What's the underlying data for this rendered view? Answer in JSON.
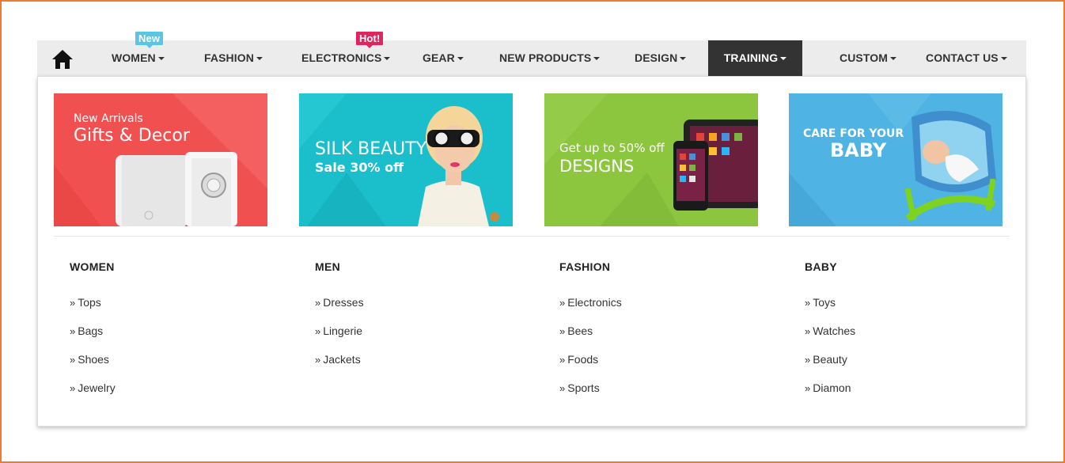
{
  "nav": {
    "items": [
      {
        "label": "WOMEN",
        "badge": "New"
      },
      {
        "label": "FASHION"
      },
      {
        "label": "ELECTRONICS",
        "badge": "Hot!"
      },
      {
        "label": "GEAR"
      },
      {
        "label": "NEW PRODUCTS"
      },
      {
        "label": "DESIGN"
      },
      {
        "label": "TRAINING",
        "active": true
      },
      {
        "label": "CUSTOM"
      },
      {
        "label": "CONTACT US"
      }
    ],
    "home_icon": "home-icon",
    "colors": {
      "bar": "#ececec",
      "active": "#333333",
      "badge_new": "#59c6e4",
      "badge_hot": "#e0245e"
    }
  },
  "banners": [
    {
      "line1": "New Arrivals",
      "line2": "Gifts & Decor",
      "color": "#f15050"
    },
    {
      "line1": "SILK BEAUTY",
      "line2": "Sale 30% off",
      "color": "#1bbfcc"
    },
    {
      "line1": "Get up to 50% off",
      "line2": "DESIGNS",
      "color": "#8cc63f"
    },
    {
      "line1": "CARE FOR YOUR",
      "line2": "BABY",
      "color": "#4fb3e3"
    }
  ],
  "columns": [
    {
      "title": "WOMEN",
      "links": [
        "Tops",
        "Bags",
        "Shoes",
        "Jewelry"
      ]
    },
    {
      "title": "MEN",
      "links": [
        "Dresses",
        "Lingerie",
        "Jackets"
      ]
    },
    {
      "title": "FASHION",
      "links": [
        "Electronics",
        "Bees",
        "Foods",
        "Sports"
      ]
    },
    {
      "title": "BABY",
      "links": [
        "Toys",
        "Watches",
        "Beauty",
        "Diamon"
      ]
    }
  ],
  "link_prefix": "»"
}
